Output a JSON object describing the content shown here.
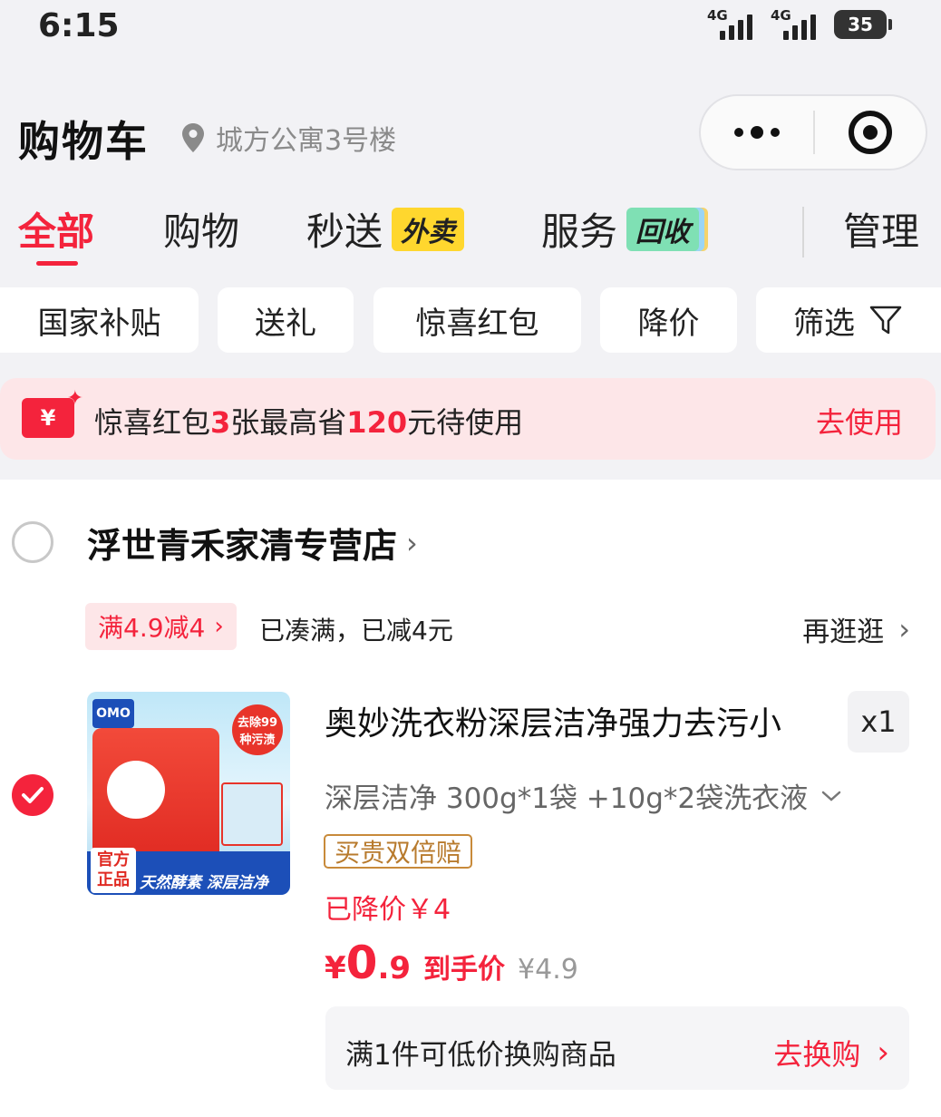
{
  "status_bar": {
    "time": "6:15",
    "network_1": "4G",
    "network_2": "4G",
    "battery": "35"
  },
  "header": {
    "title": "购物车",
    "location": "城方公寓3号楼"
  },
  "tabs": [
    {
      "label": "全部",
      "active": true
    },
    {
      "label": "购物"
    },
    {
      "label": "秒送",
      "badge": "外卖"
    },
    {
      "label": "服务",
      "badge": "回收"
    }
  ],
  "manage_label": "管理",
  "filters": [
    "国家补贴",
    "送礼",
    "惊喜红包",
    "降价",
    "筛选"
  ],
  "coupon_banner": {
    "icon": "¥",
    "text_a": "惊喜红包",
    "count": "3",
    "text_b": "张最高省",
    "amount": "120",
    "text_c": "元待使用",
    "action": "去使用"
  },
  "store": {
    "name": "浮世青禾家清专营店",
    "promo_tag": "满4.9减4",
    "promo_text": "已凑满，已减4元",
    "promo_link": "再逛逛"
  },
  "item": {
    "title": "奥妙洗衣粉深层洁净强力去污小",
    "quantity": "x1",
    "spec": "深层洁净 300g*1袋 +10g*2袋洗衣液",
    "guarantee": "买贵双倍赔",
    "price_drop": "已降价￥4",
    "price_symbol": "¥",
    "price_int": "0",
    "price_dec": ".9",
    "price_label": "到手价",
    "orig_price": "¥4.9",
    "image_text": {
      "logo": "OMO",
      "tag": "去除99种污渍",
      "official": "官方正品",
      "banner": "天然酵素 深层洁净"
    }
  },
  "exchange": {
    "text": "满1件可低价换购商品",
    "action": "去换购"
  },
  "colors": {
    "accent": "#f4233c",
    "background": "#f2f2f5",
    "coupon_bg": "#fde6e8"
  }
}
